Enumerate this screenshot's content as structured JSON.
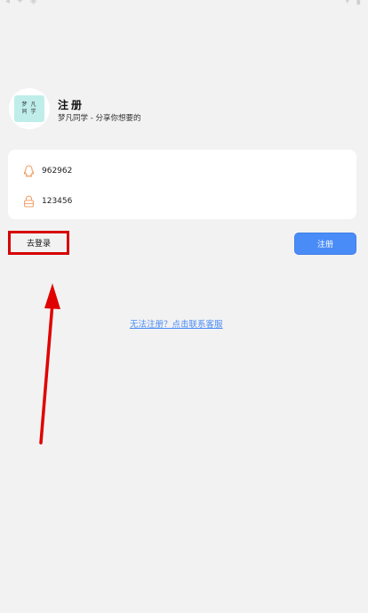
{
  "status_bar": {
    "left_icons": "◂ ✦ ◈",
    "right_icons": "▾ ▮"
  },
  "header": {
    "logo_line1": "梦 凡",
    "logo_line2": "同 学",
    "logo_caption": "· · · · ·",
    "title": "注册",
    "subtitle": "梦凡同学 - 分享你想要的"
  },
  "form": {
    "account_value": "962962",
    "password_value": "123456"
  },
  "actions": {
    "login_label": "去登录",
    "register_label": "注册"
  },
  "help": {
    "link_text": "无法注册？点击联系客服"
  },
  "colors": {
    "accent": "#4a8cf7",
    "icon_orange": "#f0a06a",
    "highlight_red": "#d60000",
    "background": "#f2f2f2"
  }
}
